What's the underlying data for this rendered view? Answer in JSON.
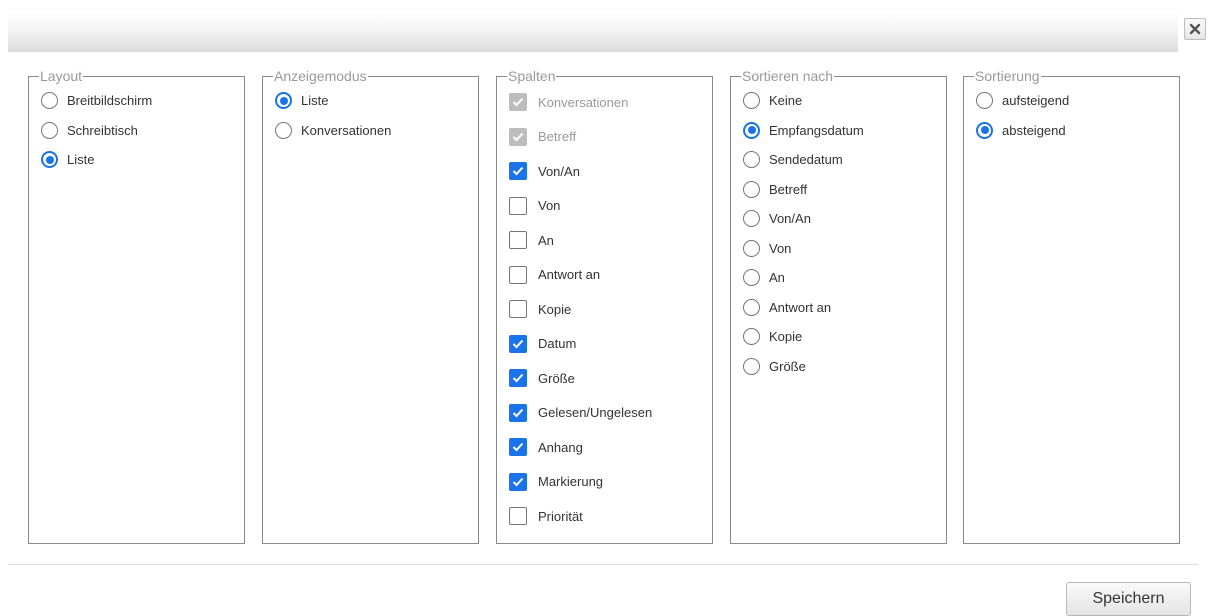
{
  "dialog": {
    "close_icon": "close-x-icon"
  },
  "layout": {
    "legend": "Layout",
    "options": [
      {
        "label": "Breitbildschirm",
        "checked": false
      },
      {
        "label": "Schreibtisch",
        "checked": false
      },
      {
        "label": "Liste",
        "checked": true
      }
    ]
  },
  "anzeigemodus": {
    "legend": "Anzeigemodus",
    "options": [
      {
        "label": "Liste",
        "checked": true
      },
      {
        "label": "Konversationen",
        "checked": false
      }
    ]
  },
  "spalten": {
    "legend": "Spalten",
    "options": [
      {
        "label": "Konversationen",
        "checked": true,
        "disabled": true
      },
      {
        "label": "Betreff",
        "checked": true,
        "disabled": true
      },
      {
        "label": "Von/An",
        "checked": true,
        "disabled": false
      },
      {
        "label": "Von",
        "checked": false,
        "disabled": false
      },
      {
        "label": "An",
        "checked": false,
        "disabled": false
      },
      {
        "label": "Antwort an",
        "checked": false,
        "disabled": false
      },
      {
        "label": "Kopie",
        "checked": false,
        "disabled": false
      },
      {
        "label": "Datum",
        "checked": true,
        "disabled": false
      },
      {
        "label": "Größe",
        "checked": true,
        "disabled": false
      },
      {
        "label": "Gelesen/Ungelesen",
        "checked": true,
        "disabled": false
      },
      {
        "label": "Anhang",
        "checked": true,
        "disabled": false
      },
      {
        "label": "Markierung",
        "checked": true,
        "disabled": false
      },
      {
        "label": "Priorität",
        "checked": false,
        "disabled": false
      }
    ]
  },
  "sortieren_nach": {
    "legend": "Sortieren nach",
    "options": [
      {
        "label": "Keine",
        "checked": false
      },
      {
        "label": "Empfangsdatum",
        "checked": true
      },
      {
        "label": "Sendedatum",
        "checked": false
      },
      {
        "label": "Betreff",
        "checked": false
      },
      {
        "label": "Von/An",
        "checked": false
      },
      {
        "label": "Von",
        "checked": false
      },
      {
        "label": "An",
        "checked": false
      },
      {
        "label": "Antwort an",
        "checked": false
      },
      {
        "label": "Kopie",
        "checked": false
      },
      {
        "label": "Größe",
        "checked": false
      }
    ]
  },
  "sortierung": {
    "legend": "Sortierung",
    "options": [
      {
        "label": "aufsteigend",
        "checked": false
      },
      {
        "label": "absteigend",
        "checked": true
      }
    ]
  },
  "footer": {
    "save_label": "Speichern"
  },
  "colors": {
    "accent": "#1a73e8",
    "border": "#8a8a8a",
    "legend": "#999999"
  }
}
